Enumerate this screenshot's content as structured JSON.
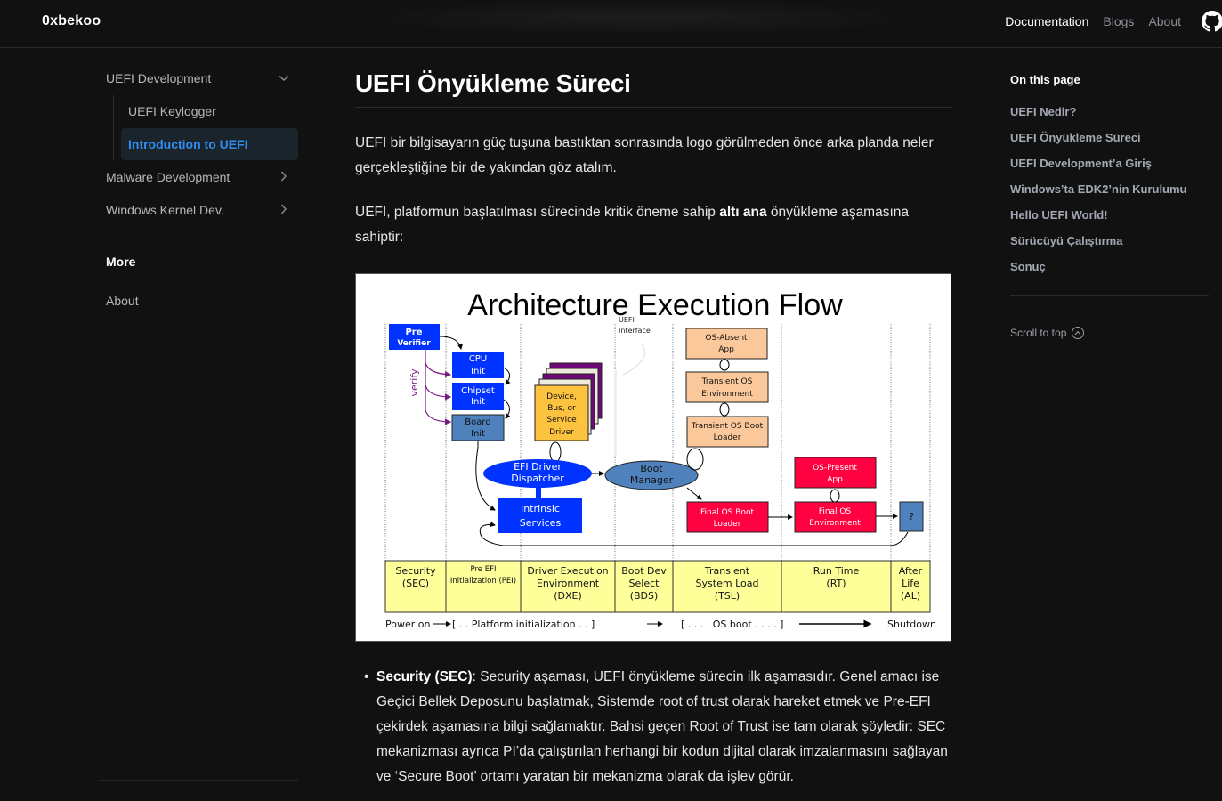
{
  "header": {
    "brand": "0xbekoo",
    "nav": [
      {
        "label": "Documentation",
        "active": true
      },
      {
        "label": "Blogs",
        "active": false
      },
      {
        "label": "About",
        "active": false
      }
    ],
    "github_icon": "github-icon"
  },
  "sidebar": {
    "groups": [
      {
        "label": "UEFI Development",
        "icon": "chevron-down-icon",
        "expanded": true,
        "children": [
          {
            "label": "UEFI Keylogger",
            "active": false
          },
          {
            "label": "Introduction to UEFI",
            "active": true
          }
        ]
      },
      {
        "label": "Malware Development",
        "icon": "chevron-right-icon",
        "expanded": false
      },
      {
        "label": "Windows Kernel Dev.",
        "icon": "chevron-right-icon",
        "expanded": false
      }
    ],
    "section_title": "More",
    "links": [
      {
        "label": "About"
      }
    ]
  },
  "main": {
    "title": "UEFI Önyükleme Süreci",
    "para1": "UEFI bir bilgisayarın güç tuşuna bastıktan sonrasında logo görülmeden önce arka planda neler gerçekleştiğine bir de yakından göz atalım.",
    "para2_pre": "UEFI, platformun başlatılması sürecinde kritik öneme sahip ",
    "para2_bold": "altı ana",
    "para2_post": " önyükleme aşamasına sahiptir:",
    "figure": {
      "title": "Architecture Execution Flow",
      "uefi_interface": [
        "UEFI",
        "Interface"
      ],
      "verify_label": "verify",
      "boxes": {
        "pre_verifier": [
          "Pre",
          "Verifier"
        ],
        "cpu_init": [
          "CPU",
          "Init"
        ],
        "chipset_init": [
          "Chipset",
          "Init"
        ],
        "board_init": [
          "Board",
          "Init"
        ],
        "device_driver": [
          "Device,",
          "Bus, or",
          "Service",
          "Driver"
        ],
        "efi_dispatcher": [
          "EFI Driver",
          "Dispatcher"
        ],
        "intrinsic_services": [
          "Intrinsic",
          "Services"
        ],
        "boot_manager": [
          "Boot",
          "Manager"
        ],
        "os_absent_app": [
          "OS-Absent",
          "App"
        ],
        "transient_os_env": [
          "Transient OS",
          "Environment"
        ],
        "transient_os_boot_loader": [
          "Transient OS Boot",
          "Loader"
        ],
        "final_os_boot_loader": [
          "Final OS Boot",
          "Loader"
        ],
        "os_present_app": [
          "OS-Present",
          "App"
        ],
        "final_os_env": [
          "Final OS",
          "Environment"
        ],
        "unknown": [
          "?"
        ]
      },
      "phases": [
        {
          "lines": [
            "Security",
            "(SEC)"
          ]
        },
        {
          "lines": [
            "Pre EFI",
            "Initialization (PEI)"
          ]
        },
        {
          "lines": [
            "Driver Execution",
            "Environment",
            "(DXE)"
          ]
        },
        {
          "lines": [
            "Boot Dev",
            "Select",
            "(BDS)"
          ]
        },
        {
          "lines": [
            "Transient",
            "System Load",
            "(TSL)"
          ]
        },
        {
          "lines": [
            "Run Time",
            "(RT)"
          ]
        },
        {
          "lines": [
            "After",
            "Life",
            "(AL)"
          ]
        }
      ],
      "footer": {
        "power_on": "Power on",
        "platform_init": "[ . . Platform initialization . . ]",
        "os_boot": "[ . . . . OS boot . . . . ]",
        "shutdown": "Shutdown"
      },
      "colors": {
        "blue": "#0033ff",
        "steel": "#4f81bd",
        "yellow_box": "#fdc23e",
        "purple": "#6e0a78",
        "peach": "#fbc89b",
        "red": "#ff0040",
        "phase_bg": "#ffff99"
      }
    },
    "bullets": [
      {
        "bold": "Security (SEC)",
        "text": ": Security aşaması, UEFI önyükleme sürecin ilk aşamasıdır. Genel amacı ise Geçici Bellek Deposunu başlatmak, Sistemde root of trust olarak hareket etmek ve Pre-EFI çekirdek aşamasına bilgi sağlamaktır. Bahsi geçen Root of Trust ise tam olarak şöyledir: SEC mekanizması ayrıca PI’da çalıştırılan herhangi bir kodun dijital olarak imzalanmasını sağlayan ve ‘Secure Boot’ ortamı yaratan bir mekanizma olarak da işlev görür."
      }
    ]
  },
  "toc": {
    "title": "On this page",
    "items": [
      "UEFI Nedir?",
      "UEFI Önyükleme Süreci",
      "UEFI Development’a Giriş",
      "Windows’ta EDK2’nin Kurulumu",
      "Hello UEFI World!",
      "Sürücüyü Çalıştırma",
      "Sonuç"
    ],
    "scroll_to_top": "Scroll to top"
  }
}
